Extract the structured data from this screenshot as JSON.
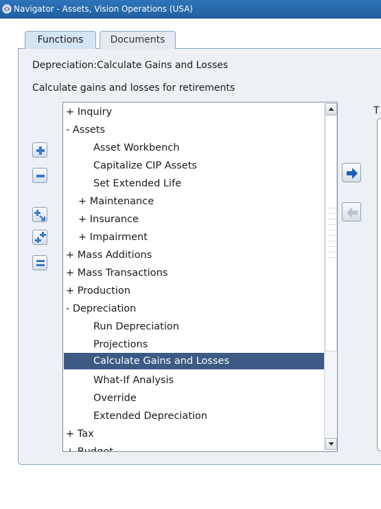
{
  "window": {
    "title": "Navigator - Assets, Vision Operations (USA)"
  },
  "tabs": [
    {
      "label": "Functions",
      "active": true
    },
    {
      "label": "Documents",
      "active": false
    }
  ],
  "description": {
    "name": "Depreciation:Calculate Gains and Losses",
    "detail": "Calculate gains and losses for retirements"
  },
  "side_buttons": [
    {
      "icon": "expand-plus-icon"
    },
    {
      "icon": "collapse-minus-icon"
    },
    {
      "icon": "expand-branch-icon"
    },
    {
      "icon": "expand-all-icon"
    },
    {
      "icon": "collapse-all-icon"
    }
  ],
  "tree": {
    "selected_index": 18,
    "items": [
      {
        "label": "+ Inquiry"
      },
      {
        "label": "- Assets"
      },
      {
        "label": "Asset Workbench"
      },
      {
        "label": "Capitalize CIP Assets"
      },
      {
        "label": "Set Extended Life"
      },
      {
        "label": "+ Maintenance"
      },
      {
        "label": "+ Insurance"
      },
      {
        "label": "+ Impairment"
      },
      {
        "label": "+ Mass Additions"
      },
      {
        "label": "+ Mass Transactions"
      },
      {
        "label": "+ Production"
      },
      {
        "label": "- Depreciation"
      },
      {
        "label": "Run Depreciation"
      },
      {
        "label": "Projections"
      },
      {
        "label": "Calculate Gains and Losses"
      },
      {
        "label": "What-If Analysis"
      },
      {
        "label": "Override"
      },
      {
        "label": "Extended Depreciation"
      },
      {
        "label": "+ Tax"
      },
      {
        "label": "+ Budget"
      }
    ]
  },
  "middle_buttons": [
    {
      "icon": "add-to-top-ten-arrow-icon",
      "enabled": true
    },
    {
      "icon": "remove-from-top-ten-arrow-icon",
      "enabled": false
    }
  ],
  "right_panel": {
    "label": "T"
  },
  "colors": {
    "title_bar": "#1f5f9f",
    "selection": "#3c5a84",
    "active_tab": "#d3e4f3",
    "arrow_blue": "#1a5fb4"
  }
}
